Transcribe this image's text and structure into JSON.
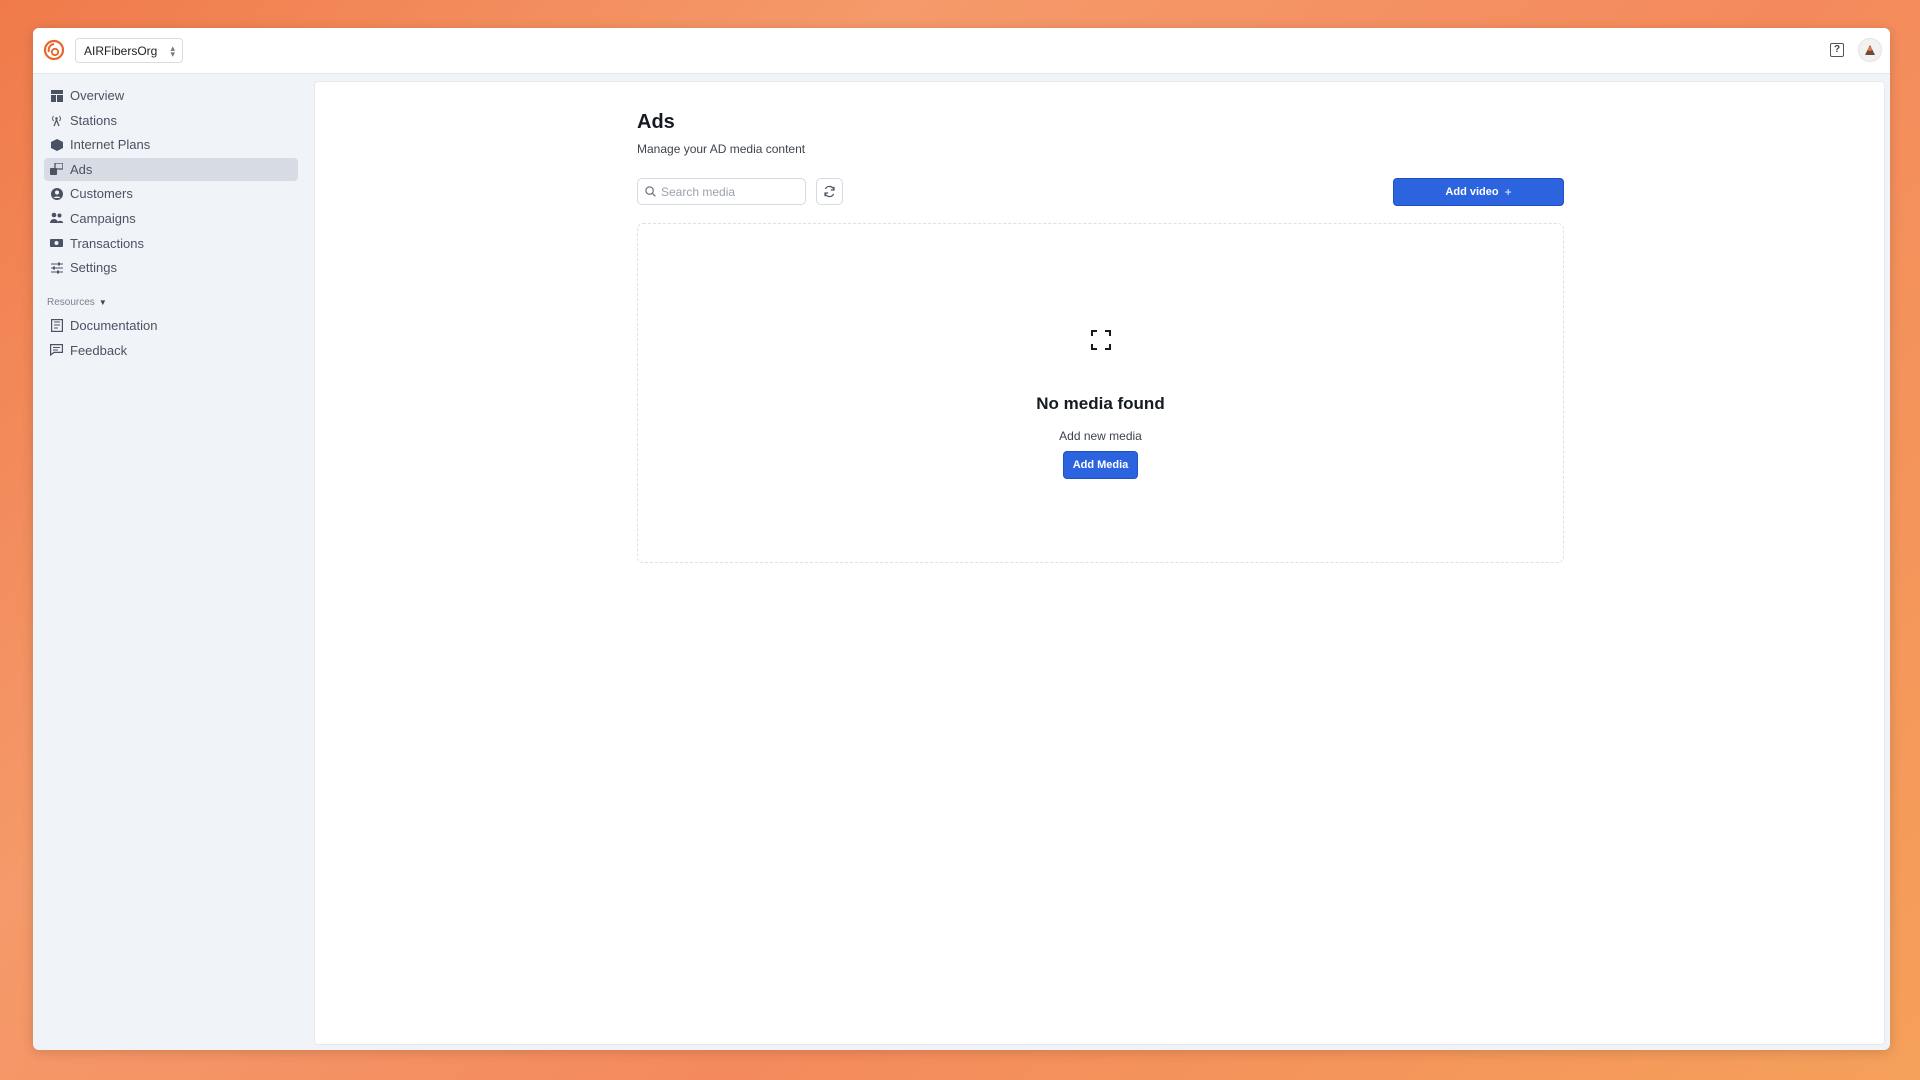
{
  "org": {
    "name": "AIRFibersOrg"
  },
  "icons": {
    "logo": "brand-logo-icon",
    "help": "help-icon",
    "avatar": "user-avatar-icon",
    "search": "search-icon",
    "refresh": "refresh-icon",
    "plus": "plus-icon",
    "empty": "scan-frame-icon"
  },
  "sidebar": {
    "items": [
      {
        "label": "Overview",
        "icon": "dashboard-icon",
        "active": false
      },
      {
        "label": "Stations",
        "icon": "antenna-icon",
        "active": false
      },
      {
        "label": "Internet Plans",
        "icon": "box-icon",
        "active": false
      },
      {
        "label": "Ads",
        "icon": "ads-icon",
        "active": true
      },
      {
        "label": "Customers",
        "icon": "user-circle-icon",
        "active": false
      },
      {
        "label": "Campaigns",
        "icon": "users-group-icon",
        "active": false
      },
      {
        "label": "Transactions",
        "icon": "cash-icon",
        "active": false
      },
      {
        "label": "Settings",
        "icon": "sliders-icon",
        "active": false
      }
    ],
    "resources_label": "Resources",
    "resources": [
      {
        "label": "Documentation",
        "icon": "book-icon"
      },
      {
        "label": "Feedback",
        "icon": "message-icon"
      }
    ]
  },
  "page": {
    "title": "Ads",
    "subtitle": "Manage your AD media content"
  },
  "toolbar": {
    "search_placeholder": "Search media",
    "add_video_label": "Add video",
    "add_video_suffix": "+"
  },
  "empty_state": {
    "title": "No media found",
    "subtitle": "Add new media",
    "button_label": "Add Media"
  },
  "colors": {
    "accent": "#2c64e0",
    "active_nav": "#d7dce4",
    "background": "#f0f3f7"
  }
}
